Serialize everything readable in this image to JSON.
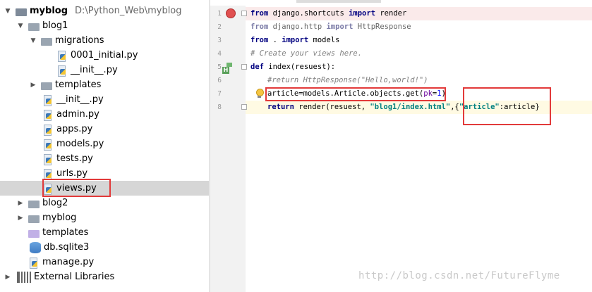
{
  "project": {
    "root_name": "myblog",
    "root_path": "D:\\Python_Web\\myblog",
    "items": [
      {
        "label": "blog1"
      },
      {
        "label": "migrations"
      },
      {
        "label": "0001_initial.py"
      },
      {
        "label": "__init__.py"
      },
      {
        "label": "templates"
      },
      {
        "label": "__init__.py"
      },
      {
        "label": "admin.py"
      },
      {
        "label": "apps.py"
      },
      {
        "label": "models.py"
      },
      {
        "label": "tests.py"
      },
      {
        "label": "urls.py"
      },
      {
        "label": "views.py"
      },
      {
        "label": "blog2"
      },
      {
        "label": "myblog"
      },
      {
        "label": "templates"
      },
      {
        "label": "db.sqlite3"
      },
      {
        "label": "manage.py"
      },
      {
        "label": "External Libraries"
      }
    ]
  },
  "editor": {
    "line_numbers": [
      "1",
      "2",
      "3",
      "4",
      "5",
      "6",
      "7",
      "8"
    ],
    "lines": [
      {
        "t1": "from",
        "t2": " django.shortcuts ",
        "t3": "import",
        "t4": " render"
      },
      {
        "t1": "from",
        "t2": " django.http ",
        "t3": "import",
        "t4": " HttpResponse"
      },
      {
        "t1": "from",
        "t2": " . ",
        "t3": "import",
        "t4": " models"
      },
      {
        "comment": "# Create your views here."
      },
      {
        "t1": "def",
        "t2": " index(resuest):"
      },
      {
        "comment": "#return HttpResponse(\"Hello,world!\")"
      },
      {
        "pre": "article=models.Article.objects.get(",
        "arg": "pk",
        "eq": "=",
        "num": "1",
        "post": ")"
      },
      {
        "kw": "return",
        "mid": " render(resuest, ",
        "s1": "\"blog1/index.html\"",
        "mid2": ",",
        "brace": "{",
        "s2": "\"article\"",
        "tail": ":article}"
      }
    ]
  },
  "watermark": "http://blog.csdn.net/FutureFlyme",
  "colors": {
    "annotation": "#e23a3a",
    "keyword": "#000080",
    "string": "#008080"
  }
}
